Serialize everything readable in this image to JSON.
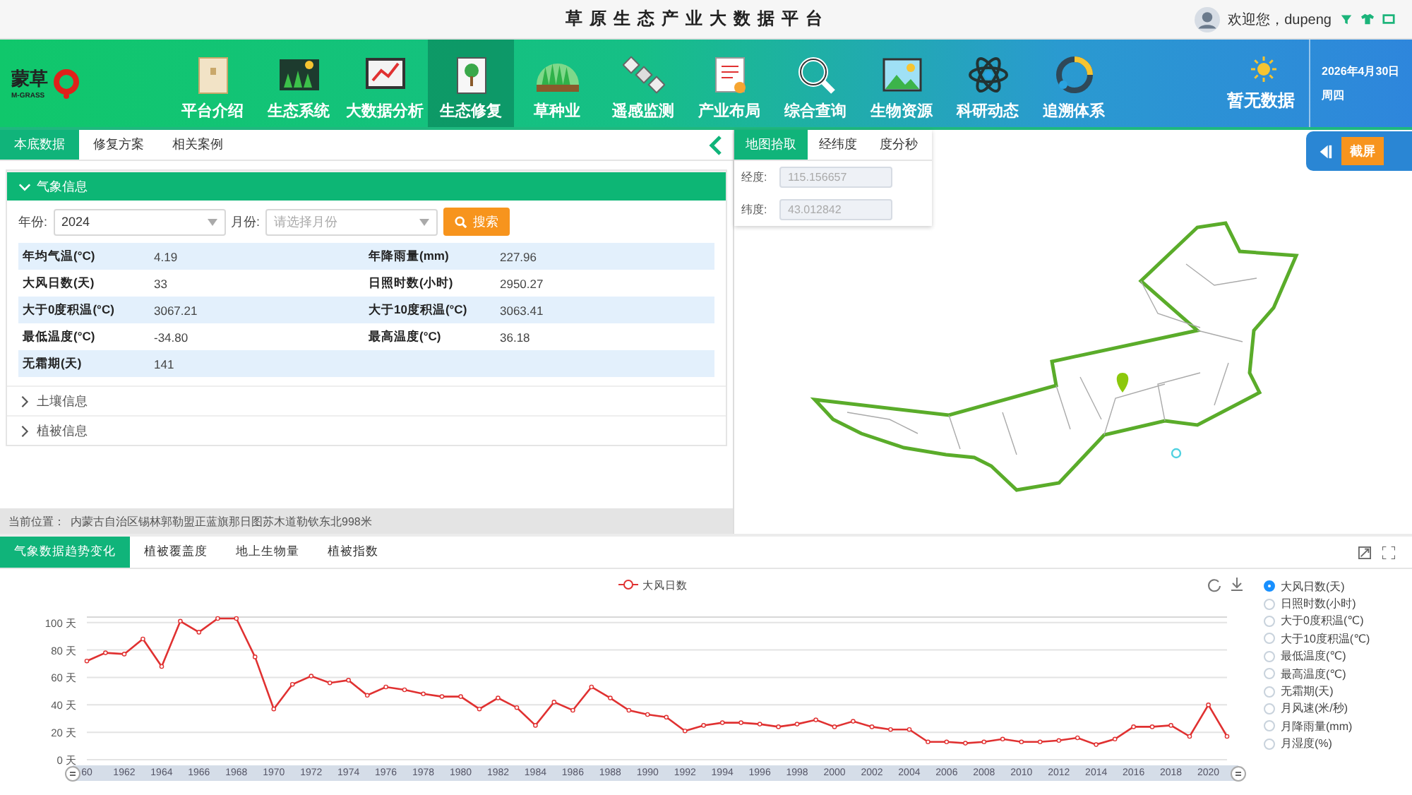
{
  "window": {
    "title": "草原生态产业大数据平台"
  },
  "user": {
    "greeting": "欢迎您，dupeng"
  },
  "logo": {
    "name": "蒙草",
    "sub": "M-GRASS"
  },
  "nav": [
    {
      "label": "平台介绍",
      "selected": false
    },
    {
      "label": "生态系统",
      "selected": false
    },
    {
      "label": "大数据分析",
      "selected": false
    },
    {
      "label": "生态修复",
      "selected": true
    },
    {
      "label": "草种业",
      "selected": false
    },
    {
      "label": "遥感监测",
      "selected": false
    },
    {
      "label": "产业布局",
      "selected": false
    },
    {
      "label": "综合查询",
      "selected": false
    },
    {
      "label": "生物资源",
      "selected": false
    },
    {
      "label": "科研动态",
      "selected": false
    },
    {
      "label": "追溯体系",
      "selected": false
    }
  ],
  "weather": {
    "text": "暂无数据",
    "date": "2026年4月30日",
    "weekday": "周四"
  },
  "left_tabs": [
    {
      "label": "本底数据",
      "selected": true
    },
    {
      "label": "修复方案",
      "selected": false
    },
    {
      "label": "相关案例",
      "selected": false
    }
  ],
  "sections": [
    {
      "title": "气象信息",
      "expanded": true
    },
    {
      "title": "土壤信息",
      "expanded": false
    },
    {
      "title": "植被信息",
      "expanded": false
    }
  ],
  "filters": {
    "year_label": "年份:",
    "year": "2024",
    "month_label": "月份:",
    "month_placeholder": "请选择月份",
    "search": "搜索"
  },
  "weather_table": [
    [
      {
        "label": "年均气温(°C)",
        "value": "4.19"
      },
      {
        "label": "年降雨量(mm)",
        "value": "227.96"
      }
    ],
    [
      {
        "label": "大风日数(天)",
        "value": "33"
      },
      {
        "label": "日照时数(小时)",
        "value": "2950.27"
      }
    ],
    [
      {
        "label": "大于0度积温(°C)",
        "value": "3067.21"
      },
      {
        "label": "大于10度积温(°C)",
        "value": "3063.41"
      }
    ],
    [
      {
        "label": "最低温度(°C)",
        "value": "-34.80"
      },
      {
        "label": "最高温度(°C)",
        "value": "36.18"
      }
    ],
    [
      {
        "label": "无霜期(天)",
        "value": "141"
      }
    ]
  ],
  "location": {
    "label": "当前位置：",
    "value": "内蒙古自治区锡林郭勒盟正蓝旗那日图苏木道勒钦东北998米"
  },
  "map_tabs": [
    {
      "label": "地图拾取",
      "selected": true
    },
    {
      "label": "经纬度",
      "selected": false
    },
    {
      "label": "度分秒",
      "selected": false
    }
  ],
  "coords": [
    {
      "label": "经度:",
      "value": "115.156657",
      "disabled": true
    },
    {
      "label": "纬度:",
      "value": "43.012842",
      "disabled": true
    }
  ],
  "screenshot_button": "截屏",
  "bottom_tabs": [
    {
      "label": "气象数据趋势变化",
      "selected": true
    },
    {
      "label": "植被覆盖度",
      "selected": false
    },
    {
      "label": "地上生物量",
      "selected": false
    },
    {
      "label": "植被指数",
      "selected": false
    }
  ],
  "chart": {
    "chart_data": {
      "type": "line",
      "x": [
        1960,
        1961,
        1962,
        1963,
        1964,
        1965,
        1966,
        1967,
        1968,
        1969,
        1970,
        1971,
        1972,
        1973,
        1974,
        1975,
        1976,
        1977,
        1978,
        1979,
        1980,
        1981,
        1982,
        1983,
        1984,
        1985,
        1986,
        1987,
        1988,
        1989,
        1990,
        1991,
        1992,
        1993,
        1994,
        1995,
        1996,
        1997,
        1998,
        1999,
        2000,
        2001,
        2002,
        2003,
        2004,
        2005,
        2006,
        2007,
        2008,
        2009,
        2010,
        2011,
        2012,
        2013,
        2014,
        2015,
        2016,
        2017,
        2018,
        2019,
        2020,
        2021
      ],
      "xticks": [
        {
          "value": 1960,
          "label": "60"
        },
        1962,
        1964,
        1966,
        1968,
        1970,
        1972,
        1974,
        1976,
        1978,
        1980,
        1982,
        1984,
        1986,
        1988,
        1990,
        1992,
        1994,
        1996,
        1998,
        2000,
        2002,
        2004,
        2006,
        2008,
        2010,
        2012,
        2014,
        2016,
        2018,
        2020
      ],
      "xlim": [
        1960,
        2021
      ],
      "ylim": [
        0,
        104
      ],
      "grid": true,
      "series": [
        {
          "name": "大风日数",
          "color": "#e03131",
          "marker": "circle",
          "values": [
            72,
            78,
            77,
            88,
            68,
            101,
            93,
            103,
            103,
            75,
            37,
            55,
            61,
            56,
            58,
            47,
            53,
            51,
            48,
            46,
            46,
            37,
            45,
            38,
            25,
            42,
            36,
            53,
            45,
            36,
            33,
            31,
            21,
            25,
            27,
            27,
            26,
            24,
            26,
            29,
            24,
            28,
            24,
            22,
            22,
            13,
            13,
            12,
            13,
            15,
            13,
            13,
            14,
            16,
            11,
            15,
            24,
            24,
            25,
            17,
            40,
            17
          ]
        }
      ],
      "yticks": [
        {
          "value": 0,
          "label": "0 天"
        },
        {
          "value": 20,
          "label": "20 天"
        },
        {
          "value": 40,
          "label": "40 天"
        },
        {
          "value": 60,
          "label": "60 天"
        },
        {
          "value": 80,
          "label": "80 天"
        },
        {
          "value": 100,
          "label": "100 天"
        }
      ]
    }
  },
  "indicators": [
    {
      "label": "大风日数(天)",
      "selected": true
    },
    {
      "label": "日照时数(小时)",
      "selected": false
    },
    {
      "label": "大于0度积温(℃)",
      "selected": false
    },
    {
      "label": "大于10度积温(℃)",
      "selected": false
    },
    {
      "label": "最低温度(℃)",
      "selected": false
    },
    {
      "label": "最高温度(℃)",
      "selected": false
    },
    {
      "label": "无霜期(天)",
      "selected": false
    },
    {
      "label": "月风速(米/秒)",
      "selected": false
    },
    {
      "label": "月降雨量(mm)",
      "selected": false
    },
    {
      "label": "月湿度(%)",
      "selected": false
    }
  ]
}
